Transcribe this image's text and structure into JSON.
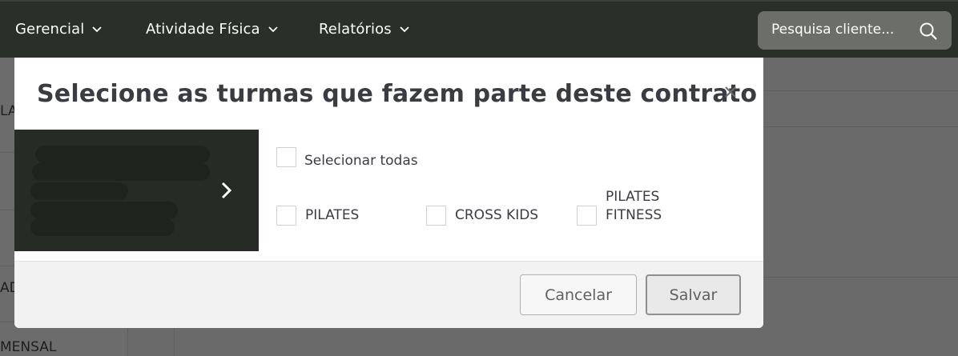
{
  "topnav": {
    "items": [
      {
        "label": "Gerencial",
        "icon": "chevron-down-icon"
      },
      {
        "label": "Atividade Física",
        "icon": "chevron-down-icon"
      },
      {
        "label": "Relatórios",
        "icon": "chevron-down-icon"
      }
    ],
    "search": {
      "placeholder": "Pesquisa cliente...",
      "icon": "search-icon"
    }
  },
  "background": {
    "fragments": [
      "LA",
      "AD",
      "MENSAL"
    ]
  },
  "modal": {
    "title": "Selecione as turmas que fazem parte deste contrato",
    "close_icon": "close-icon",
    "preview_arrow_icon": "chevron-right-icon",
    "select_all_label": "Selecionar todas",
    "options": [
      {
        "label": "PILATES",
        "checked": false
      },
      {
        "label": "CROSS KIDS",
        "checked": false
      },
      {
        "label": "PILATES FITNESS",
        "checked": false
      }
    ],
    "footer": {
      "cancel_label": "Cancelar",
      "save_label": "Salvar"
    }
  },
  "colors": {
    "nav_bg": "#2b2f29",
    "search_bg": "#6b6e69",
    "modal_bg": "#ffffff",
    "footer_bg": "#f2f2f2",
    "title_text": "#3a3c41"
  }
}
